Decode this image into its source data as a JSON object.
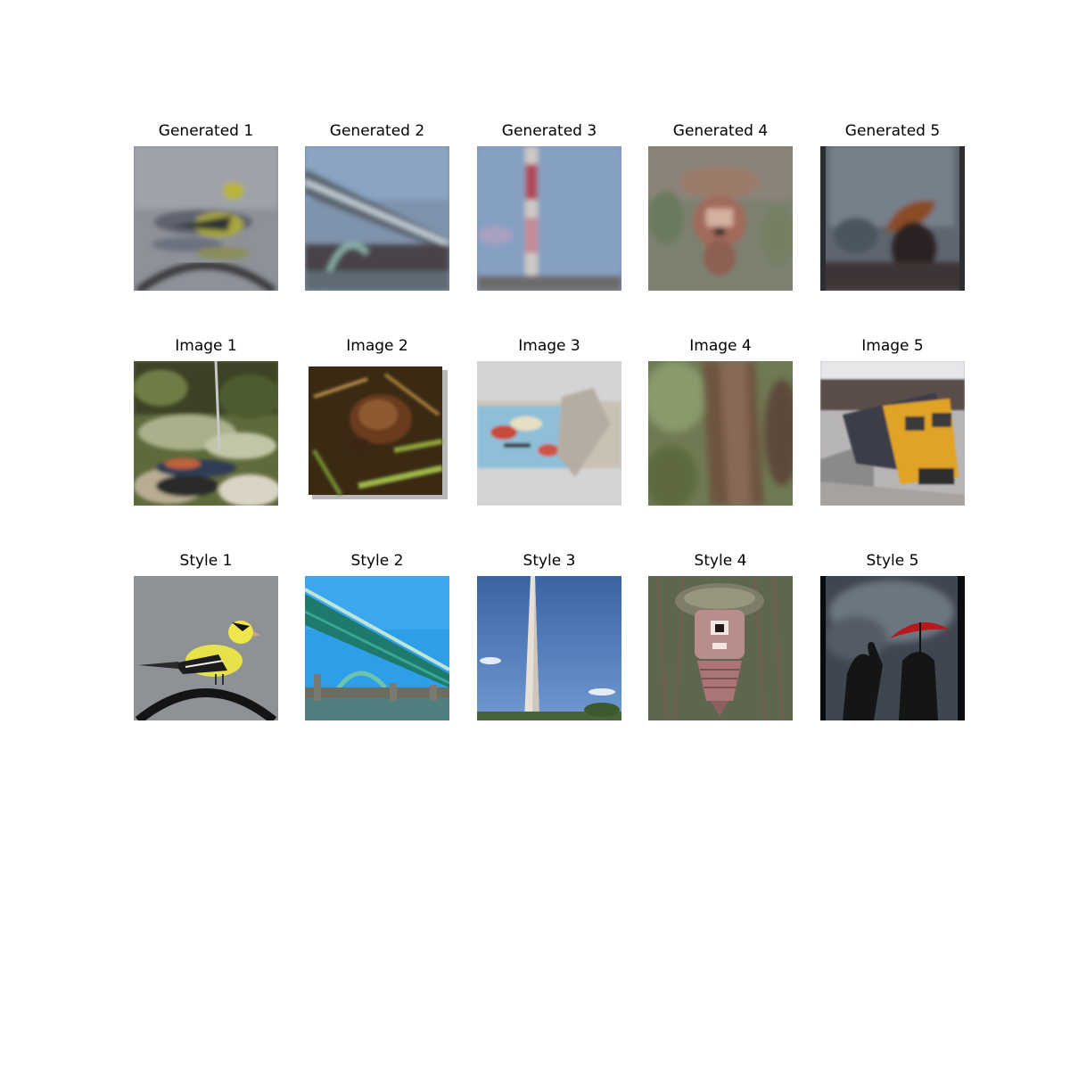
{
  "figure": {
    "rows": [
      {
        "kind": "generated",
        "tiles": [
          {
            "title": "Generated 1",
            "scene": "goldfinch-stylized"
          },
          {
            "title": "Generated 2",
            "scene": "bridge-stylized"
          },
          {
            "title": "Generated 3",
            "scene": "obelisk-stylized"
          },
          {
            "title": "Generated 4",
            "scene": "birdhouse-stylized"
          },
          {
            "title": "Generated 5",
            "scene": "umbrella-stylized"
          }
        ]
      },
      {
        "kind": "content",
        "tiles": [
          {
            "title": "Image 1",
            "scene": "bird-on-mossy-ground"
          },
          {
            "title": "Image 2",
            "scene": "snail-on-leaves"
          },
          {
            "title": "Image 3",
            "scene": "fabric-pouch"
          },
          {
            "title": "Image 4",
            "scene": "tree-bark-closeup"
          },
          {
            "title": "Image 5",
            "scene": "yellow-train-at-platform"
          }
        ]
      },
      {
        "kind": "style",
        "tiles": [
          {
            "title": "Style 1",
            "scene": "goldfinch-on-perch"
          },
          {
            "title": "Style 2",
            "scene": "green-arch-bridge"
          },
          {
            "title": "Style 3",
            "scene": "washington-monument"
          },
          {
            "title": "Style 4",
            "scene": "ceramic-birdhouse"
          },
          {
            "title": "Style 5",
            "scene": "red-umbrella-silhouettes"
          }
        ]
      }
    ]
  }
}
